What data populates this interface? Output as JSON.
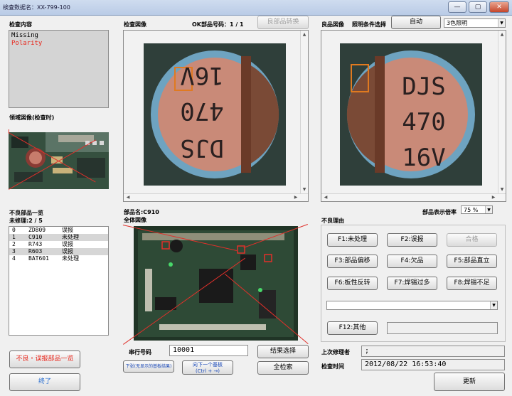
{
  "window": {
    "title": "検査数据名：XX-799-100",
    "minimize_glyph": "—",
    "maximize_glyph": "▢",
    "close_glyph": "✕"
  },
  "inspection": {
    "heading": "检查内容",
    "items": [
      "Missing",
      "Polarity"
    ],
    "item_colors": [
      "#000000",
      "#e8251a"
    ]
  },
  "area_image": {
    "heading": "领域図像(检查时)"
  },
  "defect_list": {
    "heading": "不良部品一览",
    "unprocessed": "未修理:2 / 5",
    "rows": [
      {
        "no": "0",
        "part": "ZD809",
        "status": "误报"
      },
      {
        "no": "1",
        "part": "C910",
        "status": "未处理"
      },
      {
        "no": "2",
        "part": "R743",
        "status": "误报"
      },
      {
        "no": "3",
        "part": "R603",
        "status": "误报"
      },
      {
        "no": "4",
        "part": "BAT601",
        "status": "未处理"
      }
    ]
  },
  "left_buttons": {
    "defect_list": "不良・误报部品一览",
    "finish": "终了"
  },
  "check_image": {
    "heading": "检查図像",
    "ok_part_no": "OK部品号码：1 / 1",
    "part_convert": "良部品转换",
    "chip_text": [
      "16V",
      "470",
      "DJS"
    ]
  },
  "good_image": {
    "heading": "良品図像",
    "lighting_label": "照明条件选择",
    "auto_button": "自动",
    "lighting_value": "3色照明",
    "chip_text": [
      "DJS",
      "470",
      "16V"
    ]
  },
  "whole_image": {
    "part_name": "部品名:C910",
    "heading": "全体図像",
    "display_rate_label": "部品表示倍率",
    "display_rate_value": "75 %"
  },
  "defect_reason": {
    "heading": "不良理由",
    "buttons": [
      "F1:未处理",
      "F2:误报",
      "合格",
      "F3:部品偏移",
      "F4:欠品",
      "F5:部品直立",
      "F6:板性反转",
      "F7:焊锡过多",
      "F8:焊锡不足"
    ],
    "dropdown_value": "",
    "other_button": "F12:其他",
    "other_value": ""
  },
  "bottom": {
    "serial_label": "串行号码",
    "serial_value": "10001",
    "result_select": "结果选择",
    "no_result_button": "下张(无显示的基板结果)",
    "next_board_line1": "向下一个基板",
    "next_board_line2": "(Ctrl + →)",
    "all_search": "全检索",
    "last_repairer_label": "上次修理者",
    "last_repairer_value": ";",
    "check_time_label": "检查时间",
    "check_time_value": "2012/08/22 16:53:40",
    "update_button": "更新"
  }
}
